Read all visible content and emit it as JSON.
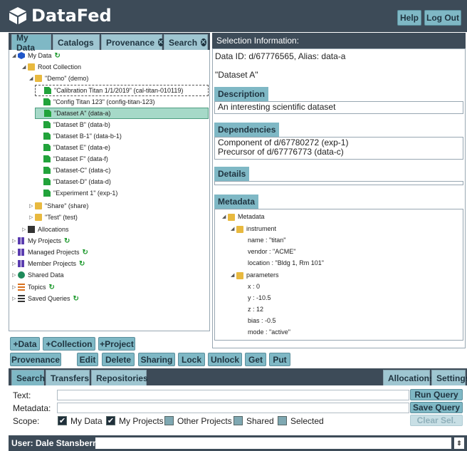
{
  "header": {
    "title": "DataFed",
    "help_label": "Help",
    "logout_label": "Log Out"
  },
  "left_tabs": [
    {
      "label": "My Data",
      "closable": false
    },
    {
      "label": "Catalogs",
      "closable": false
    },
    {
      "label": "Provenance",
      "closable": true
    },
    {
      "label": "Search",
      "closable": true
    }
  ],
  "tree": [
    {
      "label": "My Data",
      "icon": "cube"
    },
    {
      "label": "Root Collection",
      "icon": "folder"
    },
    {
      "label": "\"Demo\" (demo)",
      "icon": "folder"
    },
    {
      "label": "\"Calibration Titan 1/1/2019\" (cal-titan-010119)",
      "icon": "file"
    },
    {
      "label": "\"Config Titan 123\" (config-titan-123)",
      "icon": "file"
    },
    {
      "label": "\"Dataset A\" (data-a)",
      "icon": "file"
    },
    {
      "label": "\"Dataset B\" (data-b)",
      "icon": "file"
    },
    {
      "label": "\"Dataset B-1\" (data-b-1)",
      "icon": "file"
    },
    {
      "label": "\"Dataset E\" (data-e)",
      "icon": "file"
    },
    {
      "label": "\"Dataset F\" (data-f)",
      "icon": "file"
    },
    {
      "label": "\"Dataset-C\" (data-c)",
      "icon": "file"
    },
    {
      "label": "\"Dataset-D\" (data-d)",
      "icon": "file"
    },
    {
      "label": "\"Experiment 1\" (exp-1)",
      "icon": "file"
    },
    {
      "label": "\"Share\" (share)",
      "icon": "folder"
    },
    {
      "label": "\"Test\" (test)",
      "icon": "folder"
    },
    {
      "label": "Allocations",
      "icon": "server"
    },
    {
      "label": "My Projects",
      "icon": "grid"
    },
    {
      "label": "Managed Projects",
      "icon": "grid"
    },
    {
      "label": "Member Projects",
      "icon": "grid"
    },
    {
      "label": "Shared Data",
      "icon": "plus-circle"
    },
    {
      "label": "Topics",
      "icon": "topics"
    },
    {
      "label": "Saved Queries",
      "icon": "list"
    }
  ],
  "tree_buttons": {
    "add_data": "+Data",
    "add_collection": "+Collection",
    "add_project": "+Project"
  },
  "action_buttons": [
    "Provenance",
    "Edit",
    "Delete",
    "Sharing",
    "Lock",
    "Unlock",
    "Get",
    "Put"
  ],
  "selection": {
    "title": "Selection Information:",
    "id_line": "Data ID: d/67776565, Alias: data-a",
    "name": "\"Dataset A\"",
    "description_head": "Description",
    "description": "An interesting scientific dataset",
    "dependencies_head": "Dependencies",
    "dependencies": [
      "Component of d/67780272 (exp-1)",
      "Precursor of d/67776773 (data-c)"
    ],
    "details_head": "Details",
    "metadata_head": "Metadata",
    "metadata": [
      "Metadata",
      "instrument",
      "name : \"titan\"",
      "vendor : \"ACME\"",
      "location : \"Bldg 1, Rm 101\"",
      "parameters",
      "x : 0",
      "y : -10.5",
      "z : 12",
      "bias : -0.5",
      "mode : \"active\""
    ]
  },
  "bottom_tabs": [
    "Search",
    "Transfers",
    "Repositories"
  ],
  "bottom_right_tabs": [
    "Allocations",
    "Settings"
  ],
  "search": {
    "text_label": "Text:",
    "metadata_label": "Metadata:",
    "scope_label": "Scope:",
    "run_query": "Run Query",
    "save_query": "Save Query",
    "clear_sel": "Clear Sel.",
    "scopes": [
      {
        "label": "My Data",
        "checked": true
      },
      {
        "label": "My Projects",
        "checked": true
      },
      {
        "label": "Other Projects",
        "checked": false
      },
      {
        "label": "Shared",
        "checked": false
      },
      {
        "label": "Selected",
        "checked": false
      }
    ]
  },
  "footer": {
    "user_label": "User: Dale Stansberry"
  }
}
